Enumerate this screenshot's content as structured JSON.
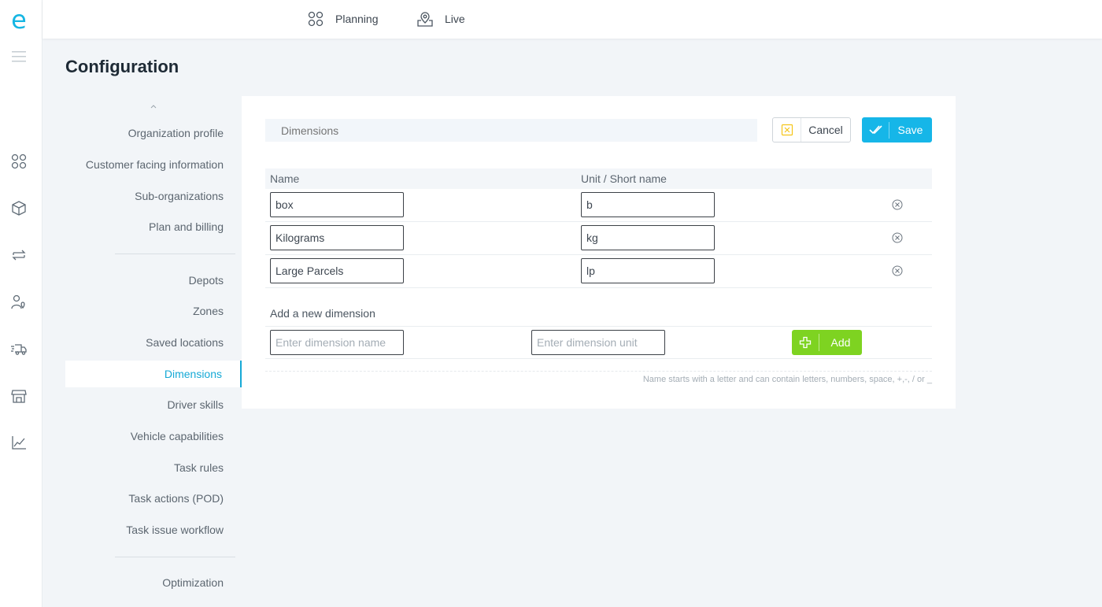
{
  "app": {
    "logo_letter": "e"
  },
  "topnav": {
    "tabs": [
      {
        "label": "Planning",
        "icon": "nodes-icon"
      },
      {
        "label": "Live",
        "icon": "map-pin-icon"
      }
    ]
  },
  "rail": {
    "icons": [
      "nodes-icon",
      "box-icon",
      "swap-icon",
      "user-pin-icon",
      "delivery-truck-icon",
      "store-icon",
      "line-chart-icon"
    ]
  },
  "page": {
    "title": "Configuration"
  },
  "menu": {
    "items": [
      {
        "label": "Organization profile"
      },
      {
        "label": "Customer facing information"
      },
      {
        "label": "Sub-organizations"
      },
      {
        "label": "Plan and billing"
      },
      {
        "label": "Depots"
      },
      {
        "label": "Zones"
      },
      {
        "label": "Saved locations"
      },
      {
        "label": "Dimensions",
        "active": true
      },
      {
        "label": "Driver skills"
      },
      {
        "label": "Vehicle capabilities"
      },
      {
        "label": "Task rules"
      },
      {
        "label": "Task actions (POD)"
      },
      {
        "label": "Task issue workflow"
      },
      {
        "label": "Optimization"
      }
    ]
  },
  "panel": {
    "title_placeholder": "Dimensions",
    "cancel_label": "Cancel",
    "save_label": "Save",
    "columns": {
      "name": "Name",
      "unit": "Unit / Short name"
    },
    "rows": [
      {
        "name": "box",
        "unit": "b"
      },
      {
        "name": "Kilograms",
        "unit": "kg"
      },
      {
        "name": "Large Parcels",
        "unit": "lp"
      }
    ],
    "add": {
      "label": "Add a new dimension",
      "name_placeholder": "Enter dimension name",
      "unit_placeholder": "Enter dimension unit",
      "button_label": "Add"
    },
    "hint": "Name starts with a letter and can contain letters, numbers, space, +,-, / or _"
  },
  "colors": {
    "accent": "#16b6e8",
    "add_green": "#7ed321",
    "cancel_icon_yellow": "#f5c518"
  }
}
